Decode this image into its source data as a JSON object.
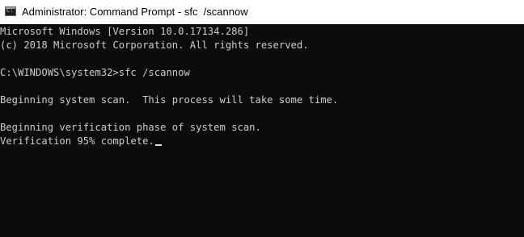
{
  "window": {
    "title": "Administrator: Command Prompt - sfc  /scannow",
    "icon": "command-prompt-icon"
  },
  "console": {
    "lines": [
      "Microsoft Windows [Version 10.0.17134.286]",
      "(c) 2018 Microsoft Corporation. All rights reserved.",
      "C:\\WINDOWS\\system32>sfc /scannow",
      "Beginning system scan.  This process will take some time.",
      "Beginning verification phase of system scan.",
      "Verification 95% complete."
    ],
    "text_color": "#cccccc",
    "background_color": "#0c0c0c"
  }
}
